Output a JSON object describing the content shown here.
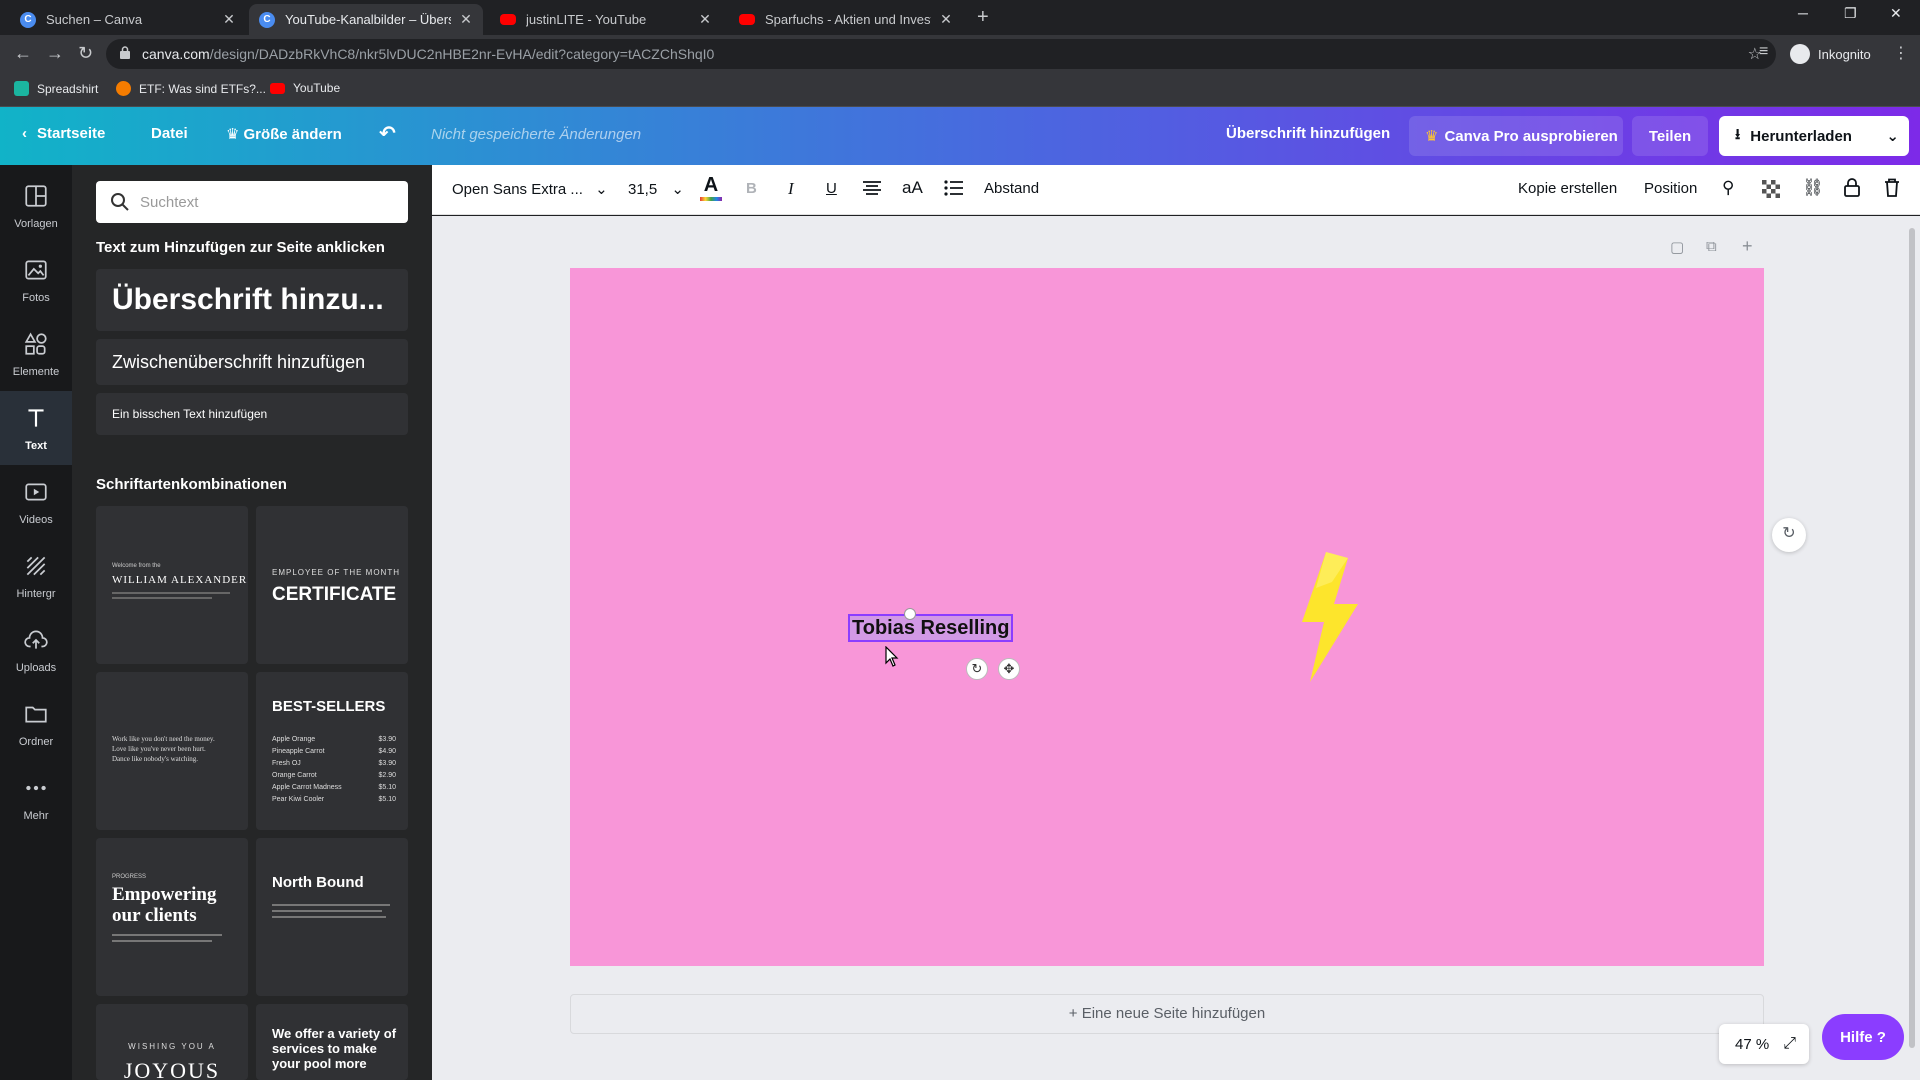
{
  "browser": {
    "tabs": [
      {
        "title": "Suchen – Canva",
        "icon": "canva-icon"
      },
      {
        "title": "YouTube-Kanalbilder – Überschrift hinzufügen",
        "icon": "canva-icon"
      },
      {
        "title": "justinLITE - YouTube",
        "icon": "youtube-icon"
      },
      {
        "title": "Sparfuchs - Aktien und Investments",
        "icon": "youtube-icon"
      }
    ],
    "url_host": "canva.com",
    "url_path": "/design/DADzbRkVhC8/nkr5lvDUC2nHBE2nr-EvHA/edit?category=tACZChShqI0",
    "profile_label": "Inkognito",
    "bookmarks": [
      {
        "label": "Spreadshirt",
        "color": "#1bb5a0"
      },
      {
        "label": "ETF: Was sind ETFs?...",
        "color": "#f57c00"
      },
      {
        "label": "YouTube",
        "color": "#ff0000"
      }
    ]
  },
  "header": {
    "home": "Startseite",
    "file": "Datei",
    "resize": "Größe ändern",
    "unsaved": "Nicht gespeicherte Änderungen",
    "design_title": "Überschrift hinzufügen",
    "pro": "Canva Pro ausprobieren",
    "share": "Teilen",
    "download": "Herunterladen"
  },
  "rail": [
    {
      "label": "Vorlagen",
      "icon": "template-icon"
    },
    {
      "label": "Fotos",
      "icon": "photo-icon"
    },
    {
      "label": "Elemente",
      "icon": "shapes-icon"
    },
    {
      "label": "Text",
      "icon": "text-icon"
    },
    {
      "label": "Videos",
      "icon": "video-icon"
    },
    {
      "label": "Hintergr",
      "icon": "background-icon"
    },
    {
      "label": "Uploads",
      "icon": "upload-icon"
    },
    {
      "label": "Ordner",
      "icon": "folder-icon"
    },
    {
      "label": "Mehr",
      "icon": "more-icon"
    }
  ],
  "panel": {
    "search_placeholder": "Suchtext",
    "add_text_title": "Text zum Hinzufügen zur Seite anklicken",
    "heading": "Überschrift hinzu...",
    "subheading": "Zwischenüberschrift hinzufügen",
    "body": "Ein bisschen Text hinzufügen",
    "combos_title": "Schriftartenkombinationen",
    "combos": {
      "c1_small": "Welcome from the",
      "c1_title": "WILLIAM ALEXANDER",
      "c2_small": "EMPLOYEE OF THE MONTH",
      "c2_title": "CERTIFICATE",
      "c3_line1": "Work like you don't need the money.",
      "c3_line2": "Love like you've never been hurt.",
      "c3_line3": "Dance like nobody's watching.",
      "c4_title": "BEST-SELLERS",
      "c4_items": [
        {
          "name": "Apple Orange",
          "price": "$3.90"
        },
        {
          "name": "Pineapple Carrot",
          "price": "$4.90"
        },
        {
          "name": "Fresh OJ",
          "price": "$3.90"
        },
        {
          "name": "Orange Carrot",
          "price": "$2.90"
        },
        {
          "name": "Apple Carrot Madness",
          "price": "$5.10"
        },
        {
          "name": "Pear Kiwi Cooler",
          "price": "$5.10"
        }
      ],
      "c5_small": "PROGRESS",
      "c5_title": "Empowering our clients",
      "c6_title": "North Bound",
      "c7_small": "WISHING YOU A",
      "c7_title": "JOYOUS",
      "c8_title": "We offer a variety of services to make your pool more"
    }
  },
  "edit_toolbar": {
    "font": "Open Sans Extra ...",
    "size": "31,5",
    "bold": "B",
    "italic": "I",
    "underline": "U",
    "case": "aA",
    "spacing": "Abstand",
    "duplicate": "Kopie erstellen",
    "position": "Position"
  },
  "canvas": {
    "background_color": "#f896d8",
    "text": "Tobias Reselling",
    "add_page": "+ Eine neue Seite hinzufügen",
    "zoom": "47 %",
    "help": "Hilfe ?"
  }
}
